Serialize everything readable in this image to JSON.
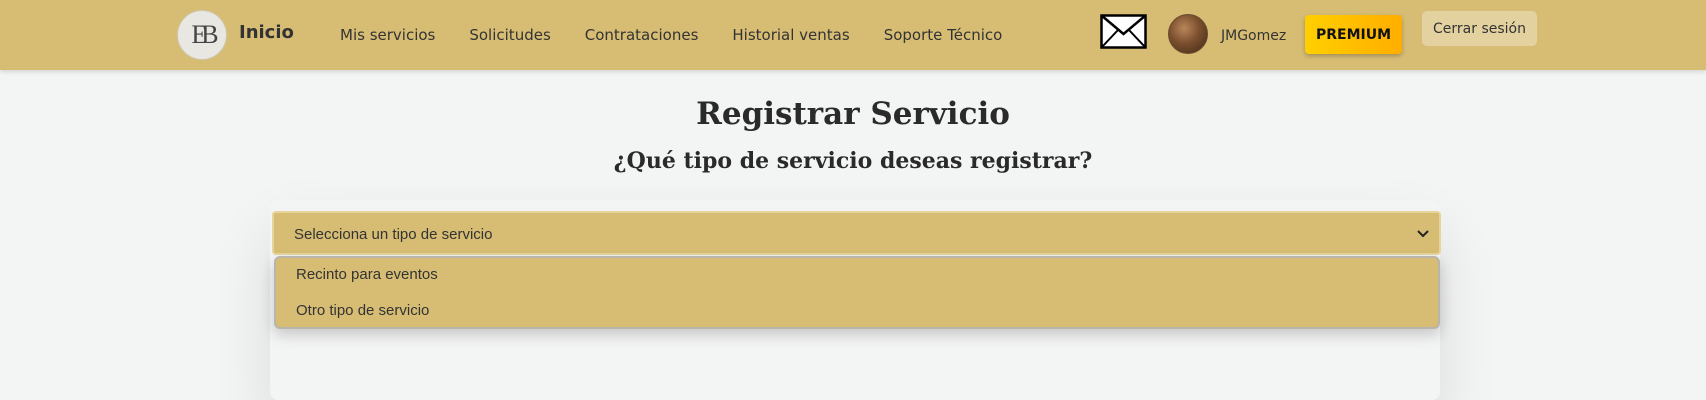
{
  "navbar": {
    "logo_letters": "EB",
    "brand": "Inicio",
    "links": [
      "Mis servicios",
      "Solicitudes",
      "Contrataciones",
      "Historial ventas",
      "Soporte Técnico"
    ],
    "username": "JMGomez",
    "premium_label": "PREMIUM",
    "logout_label": "Cerrar sesión"
  },
  "main": {
    "title": "Registrar Servicio",
    "subtitle": "¿Qué tipo de servicio deseas registrar?",
    "select": {
      "value": "Selecciona un tipo de servicio",
      "options": [
        "Recinto para eventos",
        "Otro tipo de servicio"
      ]
    }
  },
  "colors": {
    "navbar_bg": "#d7bd74",
    "page_bg": "#f3f4f4",
    "premium_gradient_start": "#ffcf00",
    "premium_gradient_end": "#ffae00"
  },
  "icons": [
    "mail-icon",
    "chevron-down-icon"
  ]
}
